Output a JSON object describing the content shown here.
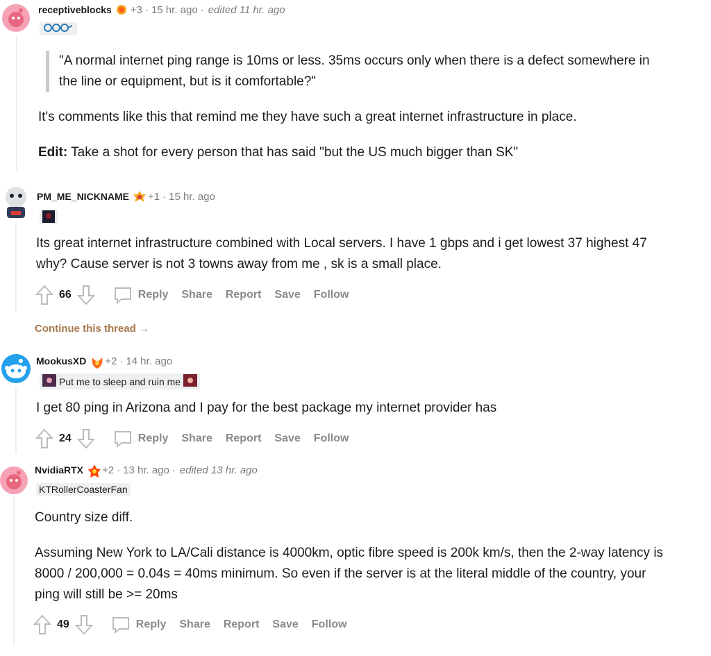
{
  "comments": [
    {
      "user": "receptiveblocks",
      "karma": "+3",
      "time": "15 hr. ago",
      "edited": "edited 11 hr. ago",
      "flair_icon": "glasses-flair-icon",
      "quote": "\"A normal internet ping range is 10ms or less. 35ms occurs only when there is a defect somewhere in the line or equipment, but is it comfortable?\"",
      "body1": "It's comments like this that remind me they have such a great internet infrastructure in place.",
      "edit_label": "Edit:",
      "edit_text": " Take a shot for every person that has said \"but the US much bigger than SK\""
    },
    {
      "user": "PM_ME_NICKNAME",
      "karma": "+1",
      "time": "15 hr. ago",
      "body": "Its great internet infrastructure combined with Local servers. I have 1 gbps and i get lowest 37 highest 47 why? Cause server is not 3 towns away from me , sk is a small place.",
      "votes": "66"
    },
    {
      "user": "MookusXD",
      "karma": "+2",
      "time": "14 hr. ago",
      "flair": "Put me to sleep and ruin me",
      "body": "I get 80 ping in Arizona and I pay for the best package my internet provider has",
      "votes": "24"
    },
    {
      "user": "NvidiaRTX",
      "karma": "+2",
      "time": "13 hr. ago",
      "edited": "edited 13 hr. ago",
      "flair": "KTRollerCoasterFan",
      "body1": "Country size diff.",
      "body2": "Assuming New York to LA/Cali distance is 4000km, optic fibre speed is 200k km/s, then the 2-way latency is 8000 / 200,000 = 0.04s = 40ms minimum. So even if the server is at the literal middle of the country, your ping will still be >= 20ms",
      "votes": "49"
    }
  ],
  "dot": "·",
  "actions": {
    "reply": "Reply",
    "share": "Share",
    "report": "Report",
    "save": "Save",
    "follow": "Follow"
  },
  "continue_thread": "Continue this thread",
  "continue_arrow": "→",
  "colors": {
    "accent_continue": "#a7794c",
    "avatar_pink": "#f7a1b6",
    "avatar_blue": "#24a0ed",
    "text_gray": "#7c7c7c"
  }
}
